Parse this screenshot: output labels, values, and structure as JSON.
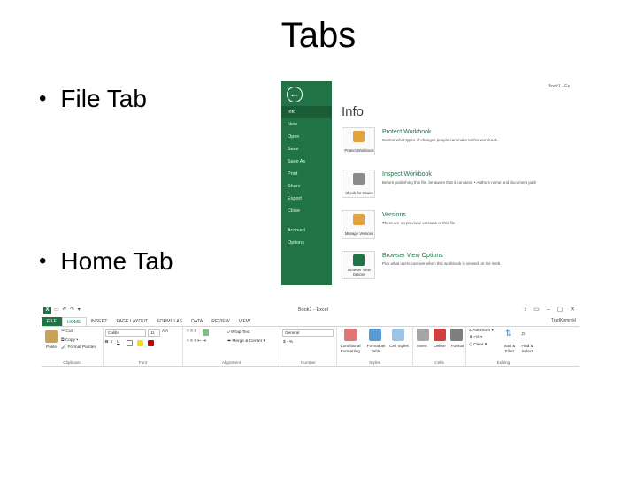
{
  "slide": {
    "title": "Tabs",
    "bullets": [
      "File Tab",
      "Home Tab"
    ]
  },
  "backstage": {
    "back_glyph": "←",
    "menu": [
      "Info",
      "New",
      "Open",
      "Save",
      "Save As",
      "Print",
      "Share",
      "Export",
      "Close",
      "Account",
      "Options"
    ],
    "selected": "Info",
    "title": "Info",
    "doc_name": "Book1 - Ex",
    "sections": [
      {
        "heading": "Protect Workbook",
        "desc": "Control what types of changes people can make to this workbook.",
        "tile": "Protect Workbook",
        "icon_color": "#e1a33a"
      },
      {
        "heading": "Inspect Workbook",
        "desc": "Before publishing this file, be aware that it contains: • Authors name and document path",
        "tile": "Check for Issues",
        "icon_color": "#8a8a8a"
      },
      {
        "heading": "Versions",
        "desc": "There are no previous versions of this file.",
        "tile": "Manage Versions",
        "icon_color": "#e1a33a"
      },
      {
        "heading": "Browser View Options",
        "desc": "Pick what users can see when this workbook is viewed on the Web.",
        "tile": "Browser View Options",
        "icon_color": "#217346"
      }
    ],
    "accent": "#217346"
  },
  "ribbon": {
    "app_letter": "X",
    "qat_icons": "▭ ↶ ↷ ▾",
    "window_title": "Book1 - Excel",
    "window_controls": "? ▭ – ▢ ✕",
    "user": "TradKomrskl",
    "tabs": [
      "FILE",
      "HOME",
      "INSERT",
      "PAGE LAYOUT",
      "FORMULAS",
      "DATA",
      "REVIEW",
      "VIEW"
    ],
    "active_tab": "HOME",
    "clipboard": {
      "paste": "Paste",
      "cut": "Cut",
      "copy": "Copy",
      "format_painter": "Format Painter",
      "label": "Clipboard"
    },
    "font": {
      "name": "Calibri",
      "size": "11",
      "label": "Font"
    },
    "alignment": {
      "wrap": "Wrap Text",
      "merge": "Merge & Center",
      "label": "Alignment"
    },
    "number": {
      "format": "General",
      "symbols": "$ - % ,",
      "label": "Number"
    },
    "styles": {
      "conditional": "Conditional Formatting",
      "format_as": "Format as Table",
      "cell": "Cell Styles",
      "label": "Styles"
    },
    "cells": {
      "insert": "Insert",
      "delete": "Delete",
      "format": "Format",
      "label": "Cells"
    },
    "editing": {
      "autosum": "AutoSum",
      "fill": "Fill",
      "clear": "Clear",
      "sort": "Sort & Filter",
      "find": "Find & Select",
      "label": "Editing"
    }
  }
}
